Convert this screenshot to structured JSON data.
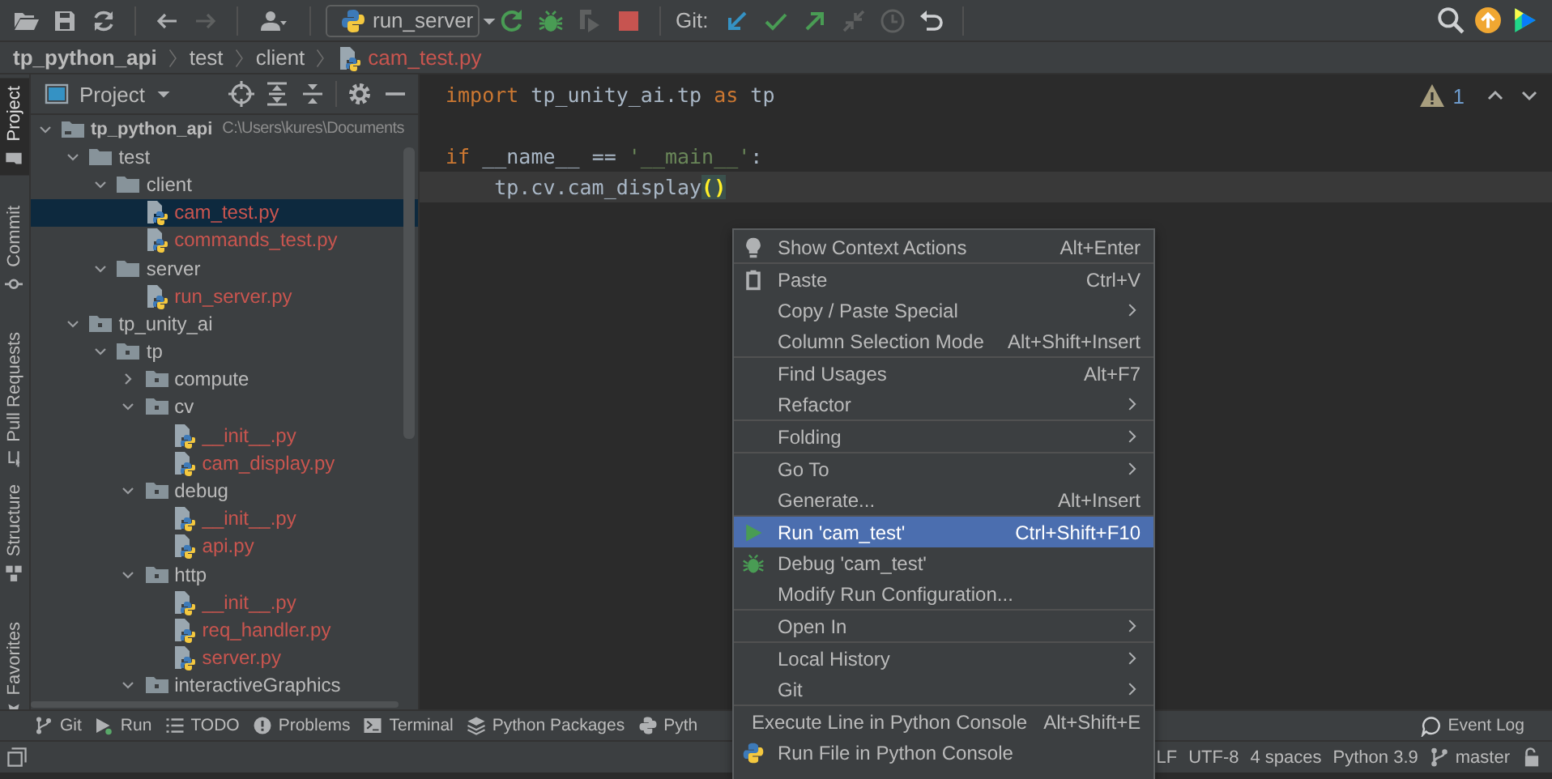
{
  "toolbar": {
    "items": [
      {
        "kind": "open",
        "disabled": false
      },
      {
        "kind": "save",
        "disabled": false
      },
      {
        "kind": "sync",
        "disabled": false
      },
      {
        "kind": "separator"
      },
      {
        "kind": "back",
        "disabled": false
      },
      {
        "kind": "forward",
        "disabled": true
      },
      {
        "kind": "separator"
      },
      {
        "kind": "user",
        "disabled": false
      },
      {
        "kind": "separator"
      },
      {
        "kind": "run_config",
        "label": "run_server"
      },
      {
        "kind": "rerun",
        "disabled": false
      },
      {
        "kind": "debug",
        "disabled": false
      },
      {
        "kind": "coverage",
        "disabled": true
      },
      {
        "kind": "stop",
        "disabled": false
      },
      {
        "kind": "separator"
      },
      {
        "kind": "label",
        "label": "Git:"
      },
      {
        "kind": "update",
        "disabled": false
      },
      {
        "kind": "commit",
        "disabled": false
      },
      {
        "kind": "push",
        "disabled": false
      },
      {
        "kind": "merge",
        "disabled": true
      },
      {
        "kind": "history",
        "disabled": true
      },
      {
        "kind": "rollback",
        "disabled": false
      },
      {
        "kind": "separator"
      }
    ],
    "right": [
      {
        "kind": "search"
      },
      {
        "kind": "upgrade"
      },
      {
        "kind": "logo"
      }
    ]
  },
  "breadcrumb": [
    {
      "kind": "project",
      "label": "tp_python_api"
    },
    {
      "kind": "folder",
      "label": "test"
    },
    {
      "kind": "folder",
      "label": "client"
    },
    {
      "kind": "file",
      "label": "cam_test.py"
    }
  ],
  "stripe": {
    "top": [
      {
        "kind": "project",
        "label": "Project",
        "selected": true
      },
      {
        "kind": "commit",
        "label": "Commit",
        "selected": false
      },
      {
        "kind": "pull_requests",
        "label": "Pull Requests",
        "selected": false
      }
    ],
    "bottom": [
      {
        "kind": "structure",
        "label": "Structure",
        "selected": false
      },
      {
        "kind": "favorites",
        "label": "Favorites",
        "selected": false
      }
    ]
  },
  "project": {
    "title": "Project",
    "tree": [
      {
        "kind": "module",
        "label": "tp_python_api",
        "hint": "C:\\Users\\kures\\Documents",
        "selected": false,
        "expanded": true,
        "children": [
          {
            "kind": "folder",
            "label": "test",
            "selected": false,
            "expanded": true,
            "children": [
              {
                "kind": "folder",
                "label": "client",
                "selected": false,
                "expanded": true,
                "children": [
                  {
                    "kind": "file",
                    "label": "cam_test.py",
                    "selected": true
                  },
                  {
                    "kind": "file",
                    "label": "commands_test.py",
                    "selected": false
                  }
                ]
              },
              {
                "kind": "folder",
                "label": "server",
                "selected": false,
                "expanded": true,
                "children": [
                  {
                    "kind": "file",
                    "label": "run_server.py",
                    "selected": false
                  }
                ]
              }
            ]
          },
          {
            "kind": "package",
            "label": "tp_unity_ai",
            "selected": false,
            "expanded": true,
            "children": [
              {
                "kind": "package",
                "label": "tp",
                "selected": false,
                "expanded": true,
                "children": [
                  {
                    "kind": "package",
                    "label": "compute",
                    "selected": false,
                    "expanded": false
                  },
                  {
                    "kind": "package",
                    "label": "cv",
                    "selected": false,
                    "expanded": true,
                    "children": [
                      {
                        "kind": "file",
                        "label": "__init__.py",
                        "selected": false
                      },
                      {
                        "kind": "file",
                        "label": "cam_display.py",
                        "selected": false
                      }
                    ]
                  },
                  {
                    "kind": "package",
                    "label": "debug",
                    "selected": false,
                    "expanded": true,
                    "children": [
                      {
                        "kind": "file",
                        "label": "__init__.py",
                        "selected": false
                      },
                      {
                        "kind": "file",
                        "label": "api.py",
                        "selected": false
                      }
                    ]
                  },
                  {
                    "kind": "package",
                    "label": "http",
                    "selected": false,
                    "expanded": true,
                    "children": [
                      {
                        "kind": "file",
                        "label": "__init__.py",
                        "selected": false
                      },
                      {
                        "kind": "file",
                        "label": "req_handler.py",
                        "selected": false
                      },
                      {
                        "kind": "file",
                        "label": "server.py",
                        "selected": false
                      }
                    ]
                  },
                  {
                    "kind": "package",
                    "label": "interactiveGraphics",
                    "selected": false,
                    "expanded": true
                  }
                ]
              }
            ]
          }
        ]
      }
    ]
  },
  "editor": {
    "inspection": {
      "warnings": "1"
    },
    "lines": [
      {
        "current": false,
        "tokens": [
          {
            "kind": "keyword",
            "text": "import"
          },
          {
            "kind": "plain",
            "text": " tp_unity_ai.tp "
          },
          {
            "kind": "keyword",
            "text": "as"
          },
          {
            "kind": "plain",
            "text": " tp"
          }
        ]
      },
      {
        "current": false
      },
      {
        "current": false,
        "tokens": [
          {
            "kind": "keyword",
            "text": "if"
          },
          {
            "kind": "plain",
            "text": " __name__ == "
          },
          {
            "kind": "string",
            "text": "'__main__'"
          },
          {
            "kind": "plain",
            "text": ":"
          }
        ]
      },
      {
        "current": true,
        "tokens": [
          {
            "kind": "plain",
            "text": "    tp.cv.cam_display"
          },
          {
            "kind": "match",
            "text": "("
          },
          {
            "kind": "match",
            "text": ")"
          }
        ]
      }
    ]
  },
  "tool_tabs": {
    "tabs": [
      {
        "kind": "git",
        "label": "Git"
      },
      {
        "kind": "run",
        "label": "Run"
      },
      {
        "kind": "todo",
        "label": "TODO"
      },
      {
        "kind": "problems",
        "label": "Problems"
      },
      {
        "kind": "terminal",
        "label": "Terminal"
      },
      {
        "kind": "packages",
        "label": "Python Packages"
      },
      {
        "kind": "console",
        "label": "Pyth"
      }
    ],
    "right": {
      "label": "Event Log"
    }
  },
  "status_bar": [
    {
      "kind": "text",
      "label": "LF"
    },
    {
      "kind": "text",
      "label": "UTF-8"
    },
    {
      "kind": "text",
      "label": "4 spaces"
    },
    {
      "kind": "text",
      "label": "Python 3.9"
    },
    {
      "kind": "branch",
      "label": "master"
    },
    {
      "kind": "lock"
    }
  ],
  "context_menu": [
    {
      "kind": "bulb",
      "label": "Show Context Actions",
      "shortcut": "Alt+Enter",
      "submenu": false,
      "selected": false
    },
    {
      "kind": "separator"
    },
    {
      "kind": "paste",
      "label": "Paste",
      "shortcut": "Ctrl+V",
      "submenu": false,
      "selected": false
    },
    {
      "kind": "item",
      "label": "Copy / Paste Special",
      "submenu": true,
      "selected": false
    },
    {
      "kind": "item",
      "label": "Column Selection Mode",
      "shortcut": "Alt+Shift+Insert",
      "submenu": false,
      "selected": false
    },
    {
      "kind": "separator"
    },
    {
      "kind": "item",
      "label": "Find Usages",
      "shortcut": "Alt+F7",
      "submenu": false,
      "selected": false
    },
    {
      "kind": "item",
      "label": "Refactor",
      "submenu": true,
      "selected": false
    },
    {
      "kind": "separator"
    },
    {
      "kind": "item",
      "label": "Folding",
      "submenu": true,
      "selected": false
    },
    {
      "kind": "separator"
    },
    {
      "kind": "item",
      "label": "Go To",
      "submenu": true,
      "selected": false
    },
    {
      "kind": "item",
      "label": "Generate...",
      "shortcut": "Alt+Insert",
      "submenu": false,
      "selected": false
    },
    {
      "kind": "separator"
    },
    {
      "kind": "run",
      "label": "Run 'cam_test'",
      "shortcut": "Ctrl+Shift+F10",
      "submenu": false,
      "selected": true
    },
    {
      "kind": "debug",
      "label": "Debug 'cam_test'",
      "submenu": false,
      "selected": false
    },
    {
      "kind": "item",
      "label": "Modify Run Configuration...",
      "submenu": false,
      "selected": false
    },
    {
      "kind": "separator"
    },
    {
      "kind": "item",
      "label": "Open In",
      "submenu": true,
      "selected": false
    },
    {
      "kind": "separator"
    },
    {
      "kind": "item",
      "label": "Local History",
      "submenu": true,
      "selected": false
    },
    {
      "kind": "item",
      "label": "Git",
      "submenu": true,
      "selected": false
    },
    {
      "kind": "separator"
    },
    {
      "kind": "item",
      "label": "Execute Line in Python Console",
      "shortcut": "Alt+Shift+E",
      "submenu": false,
      "selected": false
    },
    {
      "kind": "python",
      "label": "Run File in Python Console",
      "submenu": false,
      "selected": false
    }
  ]
}
